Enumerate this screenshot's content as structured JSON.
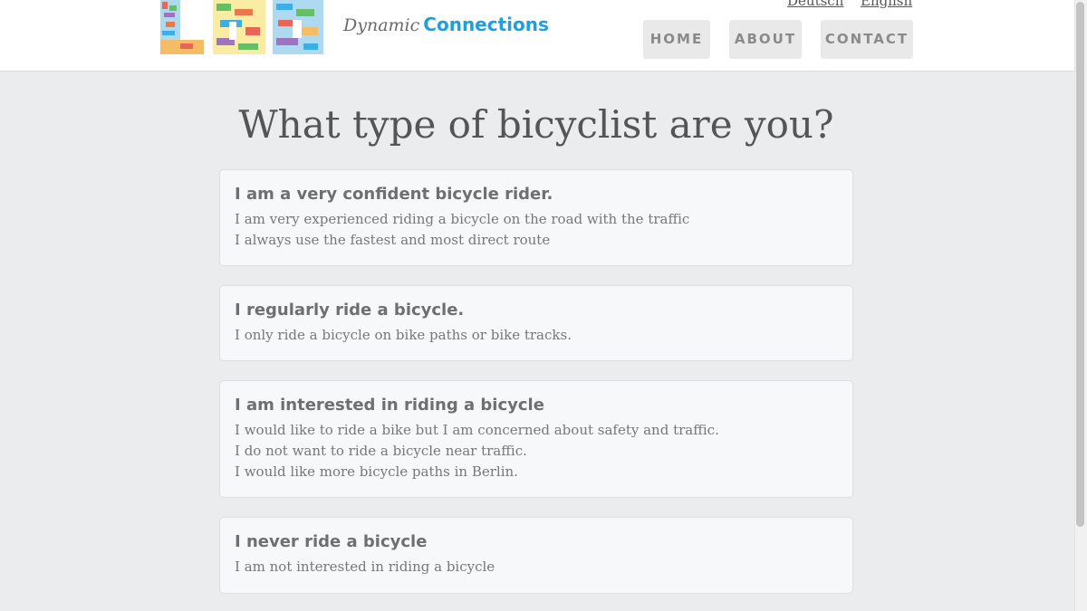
{
  "header": {
    "tagline_part1": "Dynamic",
    "tagline_part2": "Connections",
    "languages": [
      "Deutsch",
      "English"
    ],
    "nav": [
      "HOME",
      "ABOUT",
      "CONTACT"
    ],
    "accent_color": "#1ba1e2"
  },
  "main": {
    "title": "What type of bicyclist are you?",
    "options": [
      {
        "title": "I am a very confident bicycle rider.",
        "lines": [
          "I am very experienced riding a bicycle on the road with the traffic",
          "I always use the fastest and most direct route"
        ]
      },
      {
        "title": "I regularly ride a bicycle.",
        "lines": [
          "I only ride a bicycle on bike paths or bike tracks."
        ]
      },
      {
        "title": "I am interested in riding a bicycle",
        "lines": [
          "I would like to ride a bike but I am concerned about safety and traffic.",
          "I do not want to ride a bicycle near traffic.",
          "I would like more bicycle paths in Berlin."
        ]
      },
      {
        "title": "I never ride a bicycle",
        "lines": [
          "I am not interested in riding a bicycle"
        ]
      }
    ]
  }
}
